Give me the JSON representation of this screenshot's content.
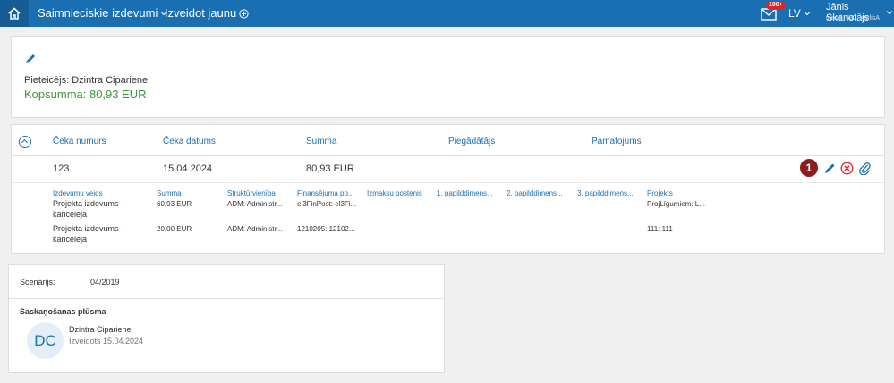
{
  "topbar": {
    "home_icon": "home-icon",
    "nav1_label": "Saimnieciskie izdevumi",
    "nav2_label": "Izveidot jaunu",
    "notifications_badge": "100+",
    "mail_icon": "envelope-icon",
    "language": "LV",
    "user_name": "Jānis Skanotājs",
    "user_db": "mssql_630_KarlisA"
  },
  "summary": {
    "applicant": "Pieteicējs: Dzintra Cipariene",
    "total": "Kopsumma: 80,93 EUR"
  },
  "receipts": {
    "headers": [
      "Čeka numurs",
      "Čeka datums",
      "Summa",
      "Piegādātājs",
      "Pamatojums"
    ],
    "row": {
      "number": "123",
      "date": "15.04.2024",
      "amount": "80,93 EUR",
      "supplier": "",
      "basis": ""
    },
    "step_badge": "1",
    "sub_headers": [
      "Izdevumu veids",
      "Summa",
      "Struktūrvienība",
      "Finansējuma po...",
      "Izmaksu postenis",
      "1. papilddimens...",
      "2. papilddimens...",
      "3. papilddimens...",
      "Projekts"
    ],
    "sub_rows": [
      {
        "type": "Projekta izdevums - kanceleja",
        "amount": "60,93 EUR",
        "unit": "ADM: Administr...",
        "funding": "el3FinPost: el3Fi...",
        "project": "ProjLīgumiem: L..."
      },
      {
        "type": "Projekta izdevums - kanceleja",
        "amount": "20,00 EUR",
        "unit": "ADM: Administr...",
        "funding": "1210205: 12102...",
        "project": "111: 111"
      }
    ]
  },
  "scenario": {
    "label": "Scenārijs:",
    "value": "04/2019",
    "flow_title": "Saskaņošanas plūsma",
    "avatar_initials": "DC",
    "person": "Dzintra Cipariene",
    "created": "Izveidots 15.04.2024"
  },
  "colors": {
    "primary": "#1a6fb3",
    "total_green": "#3a9a3a",
    "badge_red": "#8a1d1d",
    "delete_red": "#d9242b"
  }
}
